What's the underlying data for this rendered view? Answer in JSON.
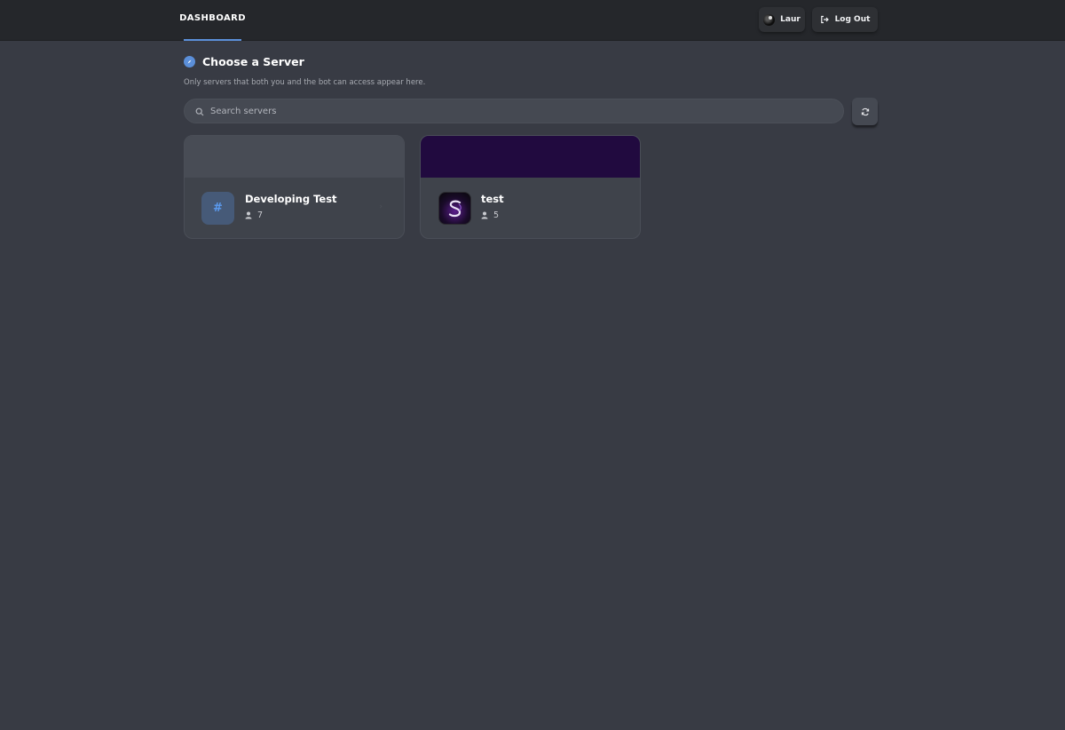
{
  "nav": {
    "tab_label": "DASHBOARD",
    "user_label": "Laur",
    "logout_label": "Log Out"
  },
  "section": {
    "title": "Choose a Server",
    "subtitle": "Only servers that both you and the bot can access appear here."
  },
  "search": {
    "placeholder": "Search servers",
    "value": ""
  },
  "servers": [
    {
      "name": "Developing Test",
      "icon_text": "#",
      "members": "7",
      "banner_color": "#484c55"
    },
    {
      "name": "test",
      "icon_text": "",
      "members": "5",
      "banner_color": "#210a3f"
    }
  ],
  "colors": {
    "accent": "#5b8fd9",
    "background": "#383b44",
    "topbar": "#25272b"
  },
  "icons": [
    "compass-icon",
    "search-icon",
    "refresh-icon",
    "logout-icon",
    "person-icon",
    "chevron-right-icon"
  ]
}
